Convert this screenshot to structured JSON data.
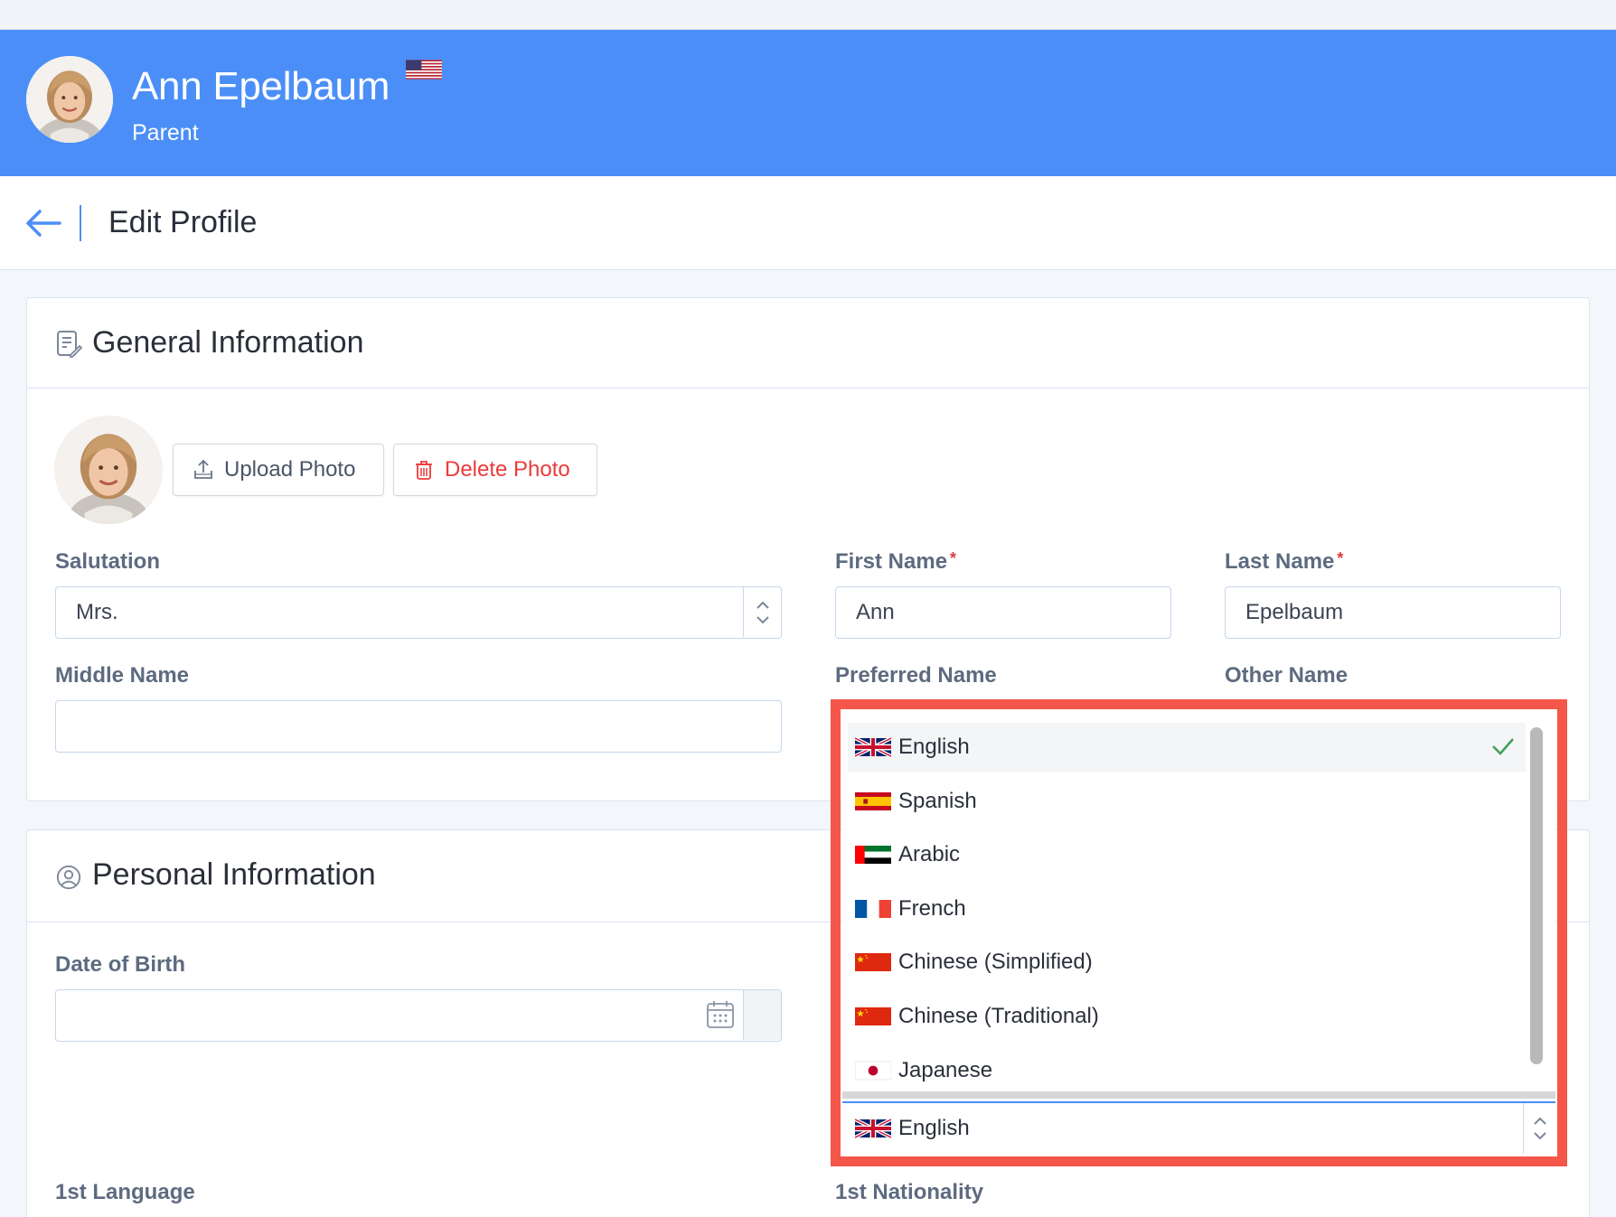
{
  "header": {
    "name": "Ann Epelbaum",
    "role": "Parent",
    "flag_icon": "us-flag-icon",
    "color": "#4b8ef7"
  },
  "editbar": {
    "back_icon": "back-arrow-icon",
    "title": "Edit Profile"
  },
  "general": {
    "title": "General Information",
    "icon": "document-edit-icon",
    "upload_label": "Upload Photo",
    "delete_label": "Delete Photo",
    "salutation_label": "Salutation",
    "salutation_value": "Mrs.",
    "first_name_label": "First Name",
    "first_name_value": "Ann",
    "last_name_label": "Last Name",
    "last_name_value": "Epelbaum",
    "required_mark": "*",
    "middle_name_label": "Middle Name",
    "middle_name_value": "",
    "preferred_name_label": "Preferred Name",
    "other_name_label": "Other Name"
  },
  "personal": {
    "title": "Personal Information",
    "icon": "user-circle-icon",
    "dob_label": "Date of Birth",
    "dob_value": "",
    "first_language_label": "1st Language",
    "first_nationality_label": "1st Nationality"
  },
  "language_dropdown": {
    "options": [
      {
        "label": "English",
        "flag": "uk-flag-icon",
        "selected": true
      },
      {
        "label": "Spanish",
        "flag": "spain-flag-icon",
        "selected": false
      },
      {
        "label": "Arabic",
        "flag": "uae-flag-icon",
        "selected": false
      },
      {
        "label": "French",
        "flag": "france-flag-icon",
        "selected": false
      },
      {
        "label": "Chinese (Simplified)",
        "flag": "china-flag-icon",
        "selected": false
      },
      {
        "label": "Chinese (Traditional)",
        "flag": "china-flag-icon",
        "selected": false
      },
      {
        "label": "Japanese",
        "flag": "japan-flag-icon",
        "selected": false
      }
    ],
    "current_value": "English",
    "highlight_color": "#f4574a"
  }
}
